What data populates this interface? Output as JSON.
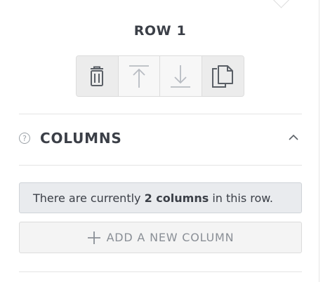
{
  "row": {
    "title": "ROW 1",
    "toolbar": [
      {
        "name": "delete-button",
        "icon": "trash-icon",
        "enabled": true
      },
      {
        "name": "move-up-button",
        "icon": "arrow-up-icon",
        "enabled": false
      },
      {
        "name": "move-down-button",
        "icon": "arrow-down-icon",
        "enabled": false
      },
      {
        "name": "duplicate-button",
        "icon": "copy-icon",
        "enabled": true
      }
    ]
  },
  "columns_section": {
    "title": "COLUMNS",
    "help_icon": "?",
    "info_prefix": "There are currently ",
    "info_count": "2 columns",
    "info_suffix": " in this row.",
    "add_button_label": "ADD A NEW COLUMN"
  },
  "colors": {
    "icon_active": "#5a5f66",
    "icon_disabled": "#b8bcc2",
    "text_dark": "#3b3f47",
    "text_muted": "#8a8f96"
  }
}
